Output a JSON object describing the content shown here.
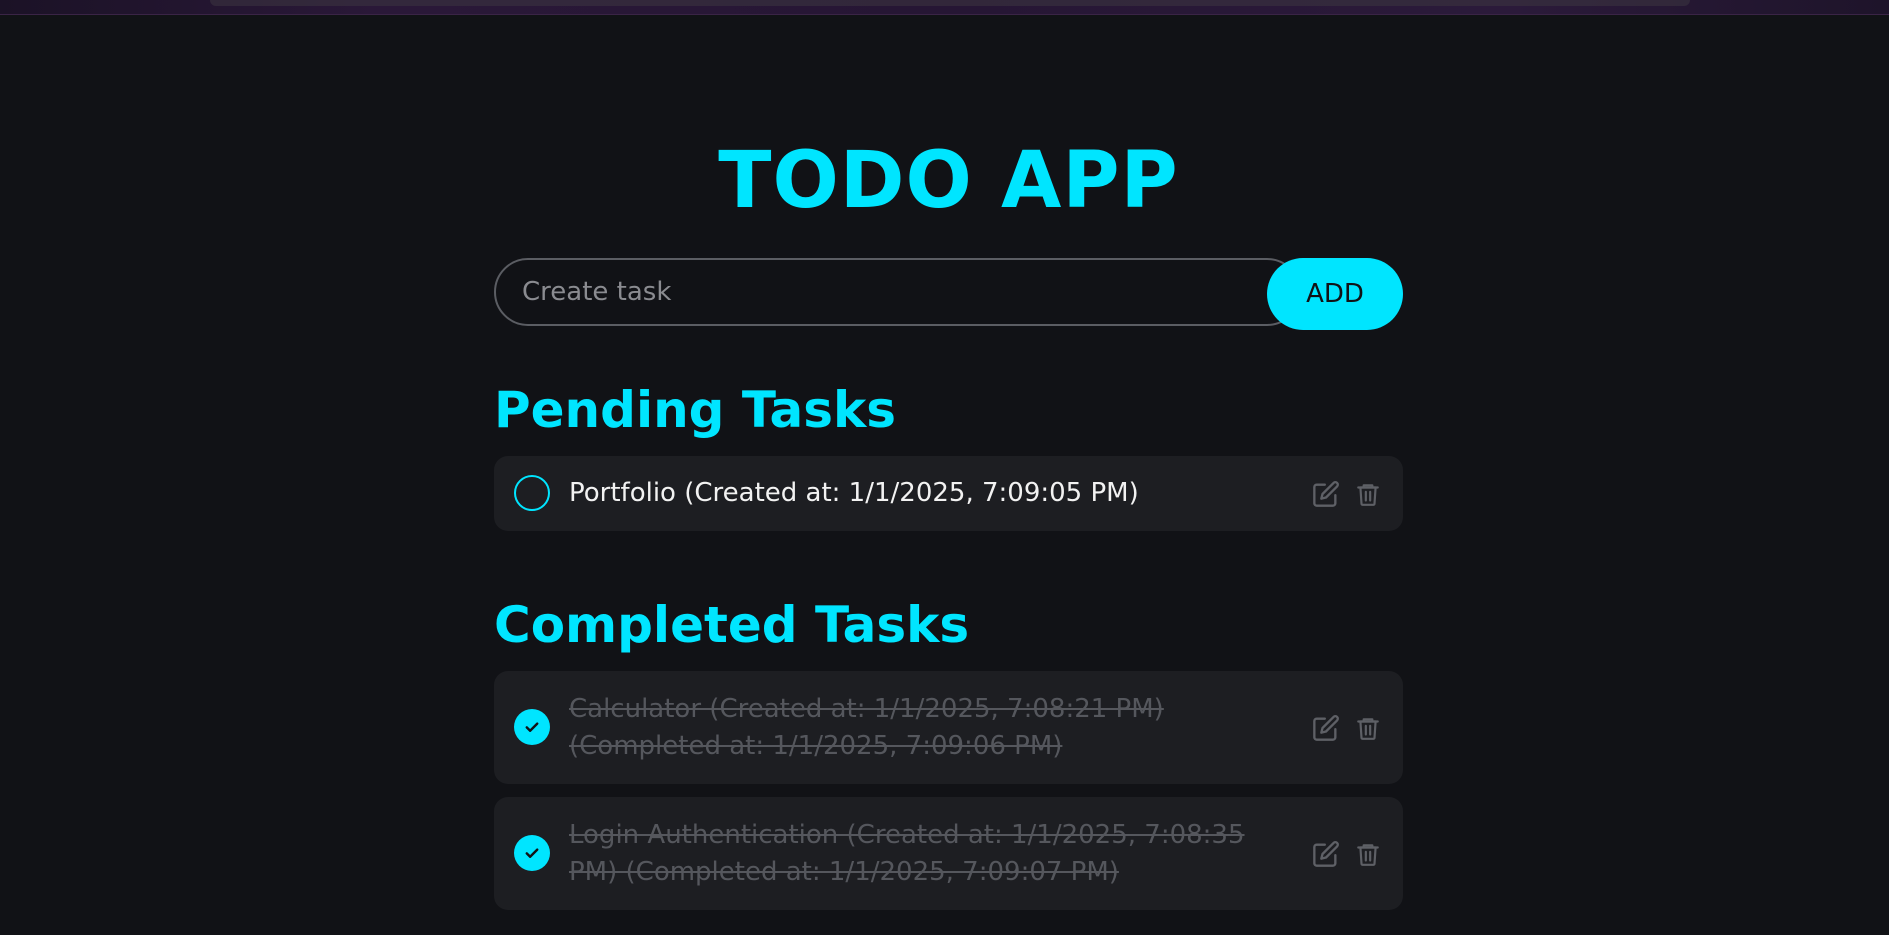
{
  "app": {
    "title": "TODO APP"
  },
  "create": {
    "placeholder": "Create task",
    "value": "",
    "add_label": "ADD"
  },
  "pending": {
    "heading": "Pending Tasks",
    "tasks": [
      {
        "text": "Portfolio (Created at: 1/1/2025, 7:09:05 PM)",
        "done": false
      }
    ]
  },
  "completed": {
    "heading": "Completed Tasks",
    "tasks": [
      {
        "text": "Calculator (Created at: 1/1/2025, 7:08:21 PM) (Completed at: 1/1/2025, 7:09:06 PM)",
        "done": true
      },
      {
        "text": "Login Authentication (Created at: 1/1/2025, 7:08:35 PM) (Completed at: 1/1/2025, 7:09:07 PM)",
        "done": true
      }
    ]
  },
  "icons": {
    "edit": "edit-icon",
    "delete": "trash-icon",
    "check": "checkmark-icon"
  },
  "colors": {
    "accent": "#00e5ff",
    "background": "#111216",
    "card": "#1d1e22",
    "muted_text": "#55575d",
    "icon": "#5e6066"
  }
}
